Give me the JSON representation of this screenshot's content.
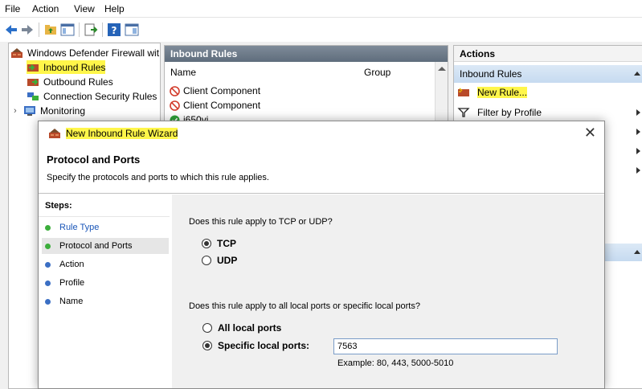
{
  "menu": [
    "File",
    "Action",
    "View",
    "Help"
  ],
  "tree": {
    "root": "Windows Defender Firewall wit",
    "items": [
      "Inbound Rules",
      "Outbound Rules",
      "Connection Security Rules",
      "Monitoring"
    ]
  },
  "center": {
    "title": "Inbound Rules",
    "columns": [
      "Name",
      "Group"
    ],
    "rows": [
      "Client Component",
      "Client Component",
      "i650vi"
    ]
  },
  "actions": {
    "title": "Actions",
    "group": "Inbound Rules",
    "items": [
      "New Rule...",
      "Filter by Profile"
    ]
  },
  "wizard": {
    "title": "New Inbound Rule Wizard",
    "heading": "Protocol and Ports",
    "subtitle": "Specify the protocols and ports to which this rule applies.",
    "steps_label": "Steps:",
    "steps": [
      "Rule Type",
      "Protocol and Ports",
      "Action",
      "Profile",
      "Name"
    ],
    "question1": "Does this rule apply to TCP or UDP?",
    "protocols": [
      "TCP",
      "UDP"
    ],
    "selected_protocol": "TCP",
    "question2": "Does this rule apply to all local ports or specific local ports?",
    "port_options": [
      "All local ports",
      "Specific local ports:"
    ],
    "selected_port_option": "Specific local ports:",
    "port_value": "7563",
    "example": "Example: 80, 443, 5000-5010"
  },
  "colors": {
    "highlight": "#fff64a",
    "step_done": "#3cae3c",
    "step_pending": "#3b6fc4",
    "header_dark": "#6b7989"
  }
}
